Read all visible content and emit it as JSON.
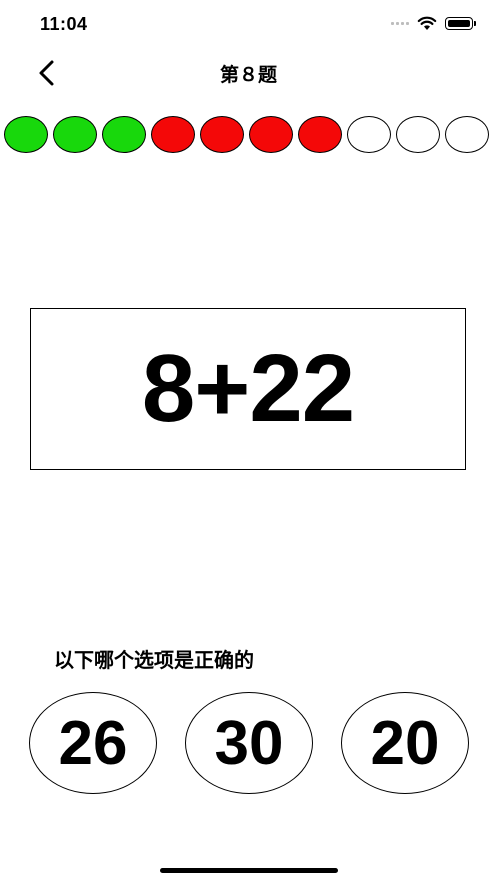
{
  "status_bar": {
    "time": "11:04"
  },
  "nav": {
    "title": "第８题"
  },
  "colors": {
    "correct": "#18d80c",
    "wrong": "#f40808",
    "pending": "#ffffff"
  },
  "progress": [
    "correct",
    "correct",
    "correct",
    "wrong",
    "wrong",
    "wrong",
    "wrong",
    "pending",
    "pending",
    "pending"
  ],
  "question": {
    "expression": "8+22"
  },
  "prompt": "以下哪个选项是正确的",
  "options": [
    {
      "label": "26"
    },
    {
      "label": "30"
    },
    {
      "label": "20"
    }
  ]
}
